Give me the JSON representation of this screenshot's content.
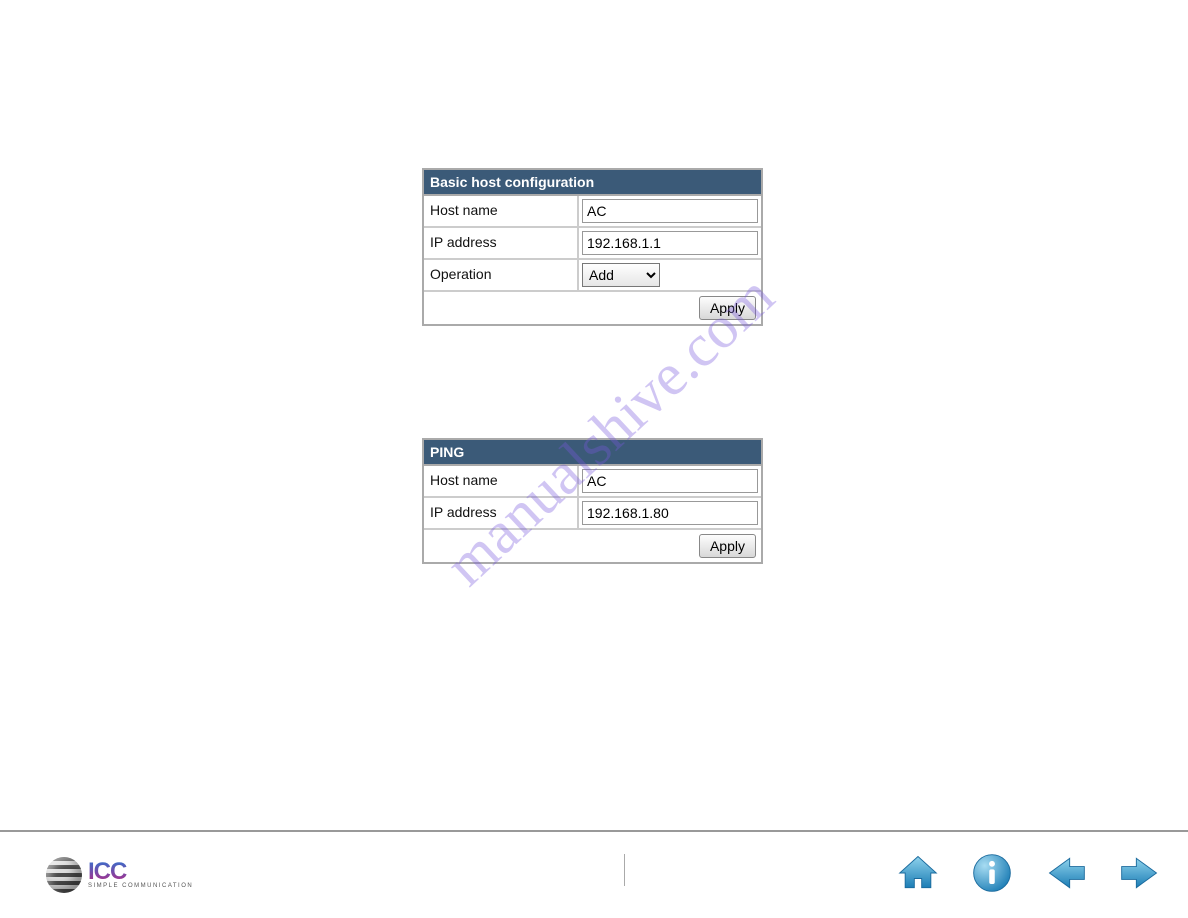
{
  "watermark": "manualshive.com",
  "panel1": {
    "title": "Basic host configuration",
    "row1_label": "Host name",
    "row1_value": "AC",
    "row2_label": "IP address",
    "row2_value": "192.168.1.1",
    "row3_label": "Operation",
    "row3_value": "Add",
    "apply": "Apply"
  },
  "panel2": {
    "title": "PING",
    "row1_label": "Host name",
    "row1_value": "AC",
    "row2_label": "IP address",
    "row2_value": "192.168.1.80",
    "apply": "Apply"
  },
  "footer": {
    "logo_text": "ICC",
    "logo_sub": "SIMPLE COMMUNICATION"
  }
}
